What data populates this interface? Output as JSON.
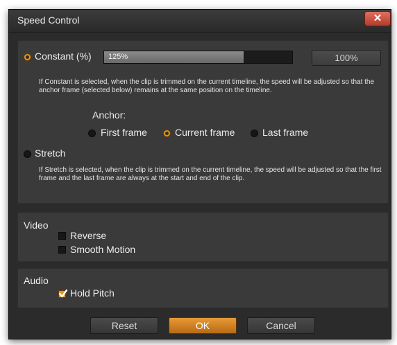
{
  "dialog": {
    "title": "Speed Control",
    "close_label": "✕"
  },
  "speed": {
    "constant_label": "Constant (%)",
    "constant_selected": true,
    "speed_value": "125%",
    "speed_fraction": 0.74,
    "preset_button_label": "100%",
    "constant_description": "If Constant is selected, when the clip is trimmed on the current timeline, the speed will be adjusted so that the anchor frame (selected below) remains at the same position on the timeline.",
    "anchor_label": "Anchor:",
    "anchor_options": [
      {
        "label": "First frame",
        "selected": false
      },
      {
        "label": "Current frame",
        "selected": true
      },
      {
        "label": "Last frame",
        "selected": false
      }
    ],
    "stretch_label": "Stretch",
    "stretch_selected": false,
    "stretch_description": "If Stretch is selected, when the clip is trimmed on the current timeline, the speed will be adjusted so that the first frame and the last frame are always at the start and end of the clip."
  },
  "video": {
    "heading": "Video",
    "reverse_label": "Reverse",
    "reverse_checked": false,
    "smooth_motion_label": "Smooth Motion",
    "smooth_motion_checked": false
  },
  "audio": {
    "heading": "Audio",
    "hold_pitch_label": "Hold Pitch",
    "hold_pitch_checked": true
  },
  "buttons": {
    "reset": "Reset",
    "ok": "OK",
    "cancel": "Cancel"
  },
  "colors": {
    "accent": "#e59522",
    "background": "#2b2b2b",
    "panel": "#3a3a3a",
    "close": "#c9503d"
  }
}
